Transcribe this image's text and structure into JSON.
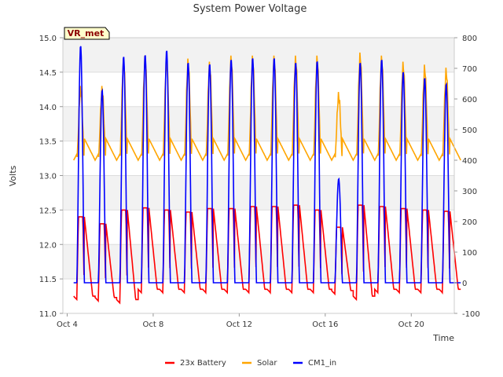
{
  "chart_data": {
    "type": "line",
    "title": "System Power Voltage",
    "xlabel": "Time",
    "ylabel": "Volts",
    "annotation": "VR_met",
    "x_ticks": [
      "Oct 4",
      "Oct 8",
      "Oct 12",
      "Oct 16",
      "Oct 20"
    ],
    "y_left": {
      "min": 11.0,
      "max": 15.0,
      "ticks": [
        "11.0",
        "11.5",
        "12.0",
        "12.5",
        "13.0",
        "13.5",
        "14.0",
        "14.5",
        "15.0"
      ]
    },
    "y_right": {
      "min": -100,
      "max": 800,
      "ticks": [
        "-100",
        "0",
        "100",
        "200",
        "300",
        "400",
        "500",
        "600",
        "700",
        "800"
      ]
    },
    "x_range_days": [
      "Oct 4",
      "Oct 22"
    ],
    "grid": true,
    "legend_position": "bottom",
    "series": [
      {
        "name": "23x Battery",
        "color": "#ff0000",
        "axis": "left",
        "y_by_day": [
          "Oct 4",
          "Oct 5",
          "Oct 6",
          "Oct 7",
          "Oct 8",
          "Oct 9",
          "Oct 10",
          "Oct 11",
          "Oct 12",
          "Oct 13",
          "Oct 14",
          "Oct 15",
          "Oct 16",
          "Oct 17",
          "Oct 18",
          "Oct 19",
          "Oct 20",
          "Oct 21"
        ],
        "night_min": [
          11.2,
          11.18,
          11.15,
          11.3,
          11.3,
          11.3,
          11.3,
          11.3,
          11.3,
          11.3,
          11.3,
          11.3,
          11.28,
          11.2,
          11.3,
          11.3,
          11.3,
          11.3
        ],
        "day_max": [
          12.4,
          12.3,
          12.5,
          12.53,
          12.5,
          12.47,
          12.52,
          12.52,
          12.55,
          12.55,
          12.57,
          12.5,
          12.25,
          12.57,
          12.55,
          12.52,
          12.5,
          12.48
        ]
      },
      {
        "name": "Solar",
        "color": "#ffa500",
        "axis": "right",
        "day_peak": [
          620,
          620,
          710,
          720,
          710,
          710,
          700,
          720,
          720,
          720,
          720,
          720,
          600,
          730,
          720,
          700,
          690,
          680
        ]
      },
      {
        "name": "CM1_in",
        "color": "#0000ff",
        "axis": "right",
        "day_peak": [
          775,
          630,
          740,
          745,
          760,
          720,
          715,
          730,
          735,
          735,
          720,
          725,
          340,
          720,
          730,
          690,
          670,
          650
        ]
      }
    ]
  }
}
